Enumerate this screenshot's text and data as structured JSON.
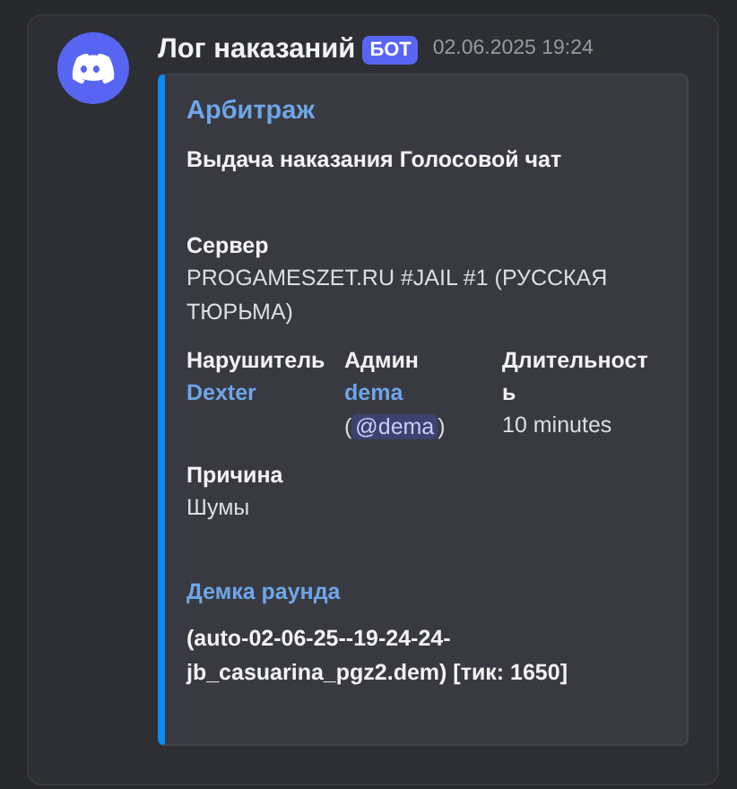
{
  "message": {
    "author": "Лог наказаний",
    "badge": "БОТ",
    "timestamp": "02.06.2025 19:24",
    "embed": {
      "title": "Арбитраж",
      "description": "Выдача наказания Голосовой чат",
      "fields": [
        {
          "name": "Сервер",
          "inline": false,
          "lines": [
            [
              {
                "kind": "text",
                "text": "PROGAMESZET.RU #JAIL #1 (РУССКАЯ ТЮРЬМА)"
              }
            ]
          ]
        },
        {
          "name": "Нарушитель",
          "inline": true,
          "lines": [
            [
              {
                "kind": "link",
                "text": "Dexter"
              }
            ]
          ]
        },
        {
          "name": "Админ",
          "inline": true,
          "lines": [
            [
              {
                "kind": "link",
                "text": "dema"
              }
            ],
            [
              {
                "kind": "text",
                "text": "("
              },
              {
                "kind": "mention",
                "text": "@dema"
              },
              {
                "kind": "text",
                "text": ")"
              }
            ]
          ]
        },
        {
          "name": "Длительность",
          "inline": true,
          "lines": [
            [
              {
                "kind": "text",
                "text": "10 minutes"
              }
            ]
          ]
        },
        {
          "name": "Причина",
          "inline": false,
          "lines": [
            [
              {
                "kind": "text",
                "text": "Шумы"
              }
            ]
          ]
        }
      ],
      "section": {
        "title": "Демка раунда",
        "text": "(auto-02-06-25--19-24-24-jb_casuarina_pgz2.dem) [тик: 1650]"
      }
    }
  }
}
